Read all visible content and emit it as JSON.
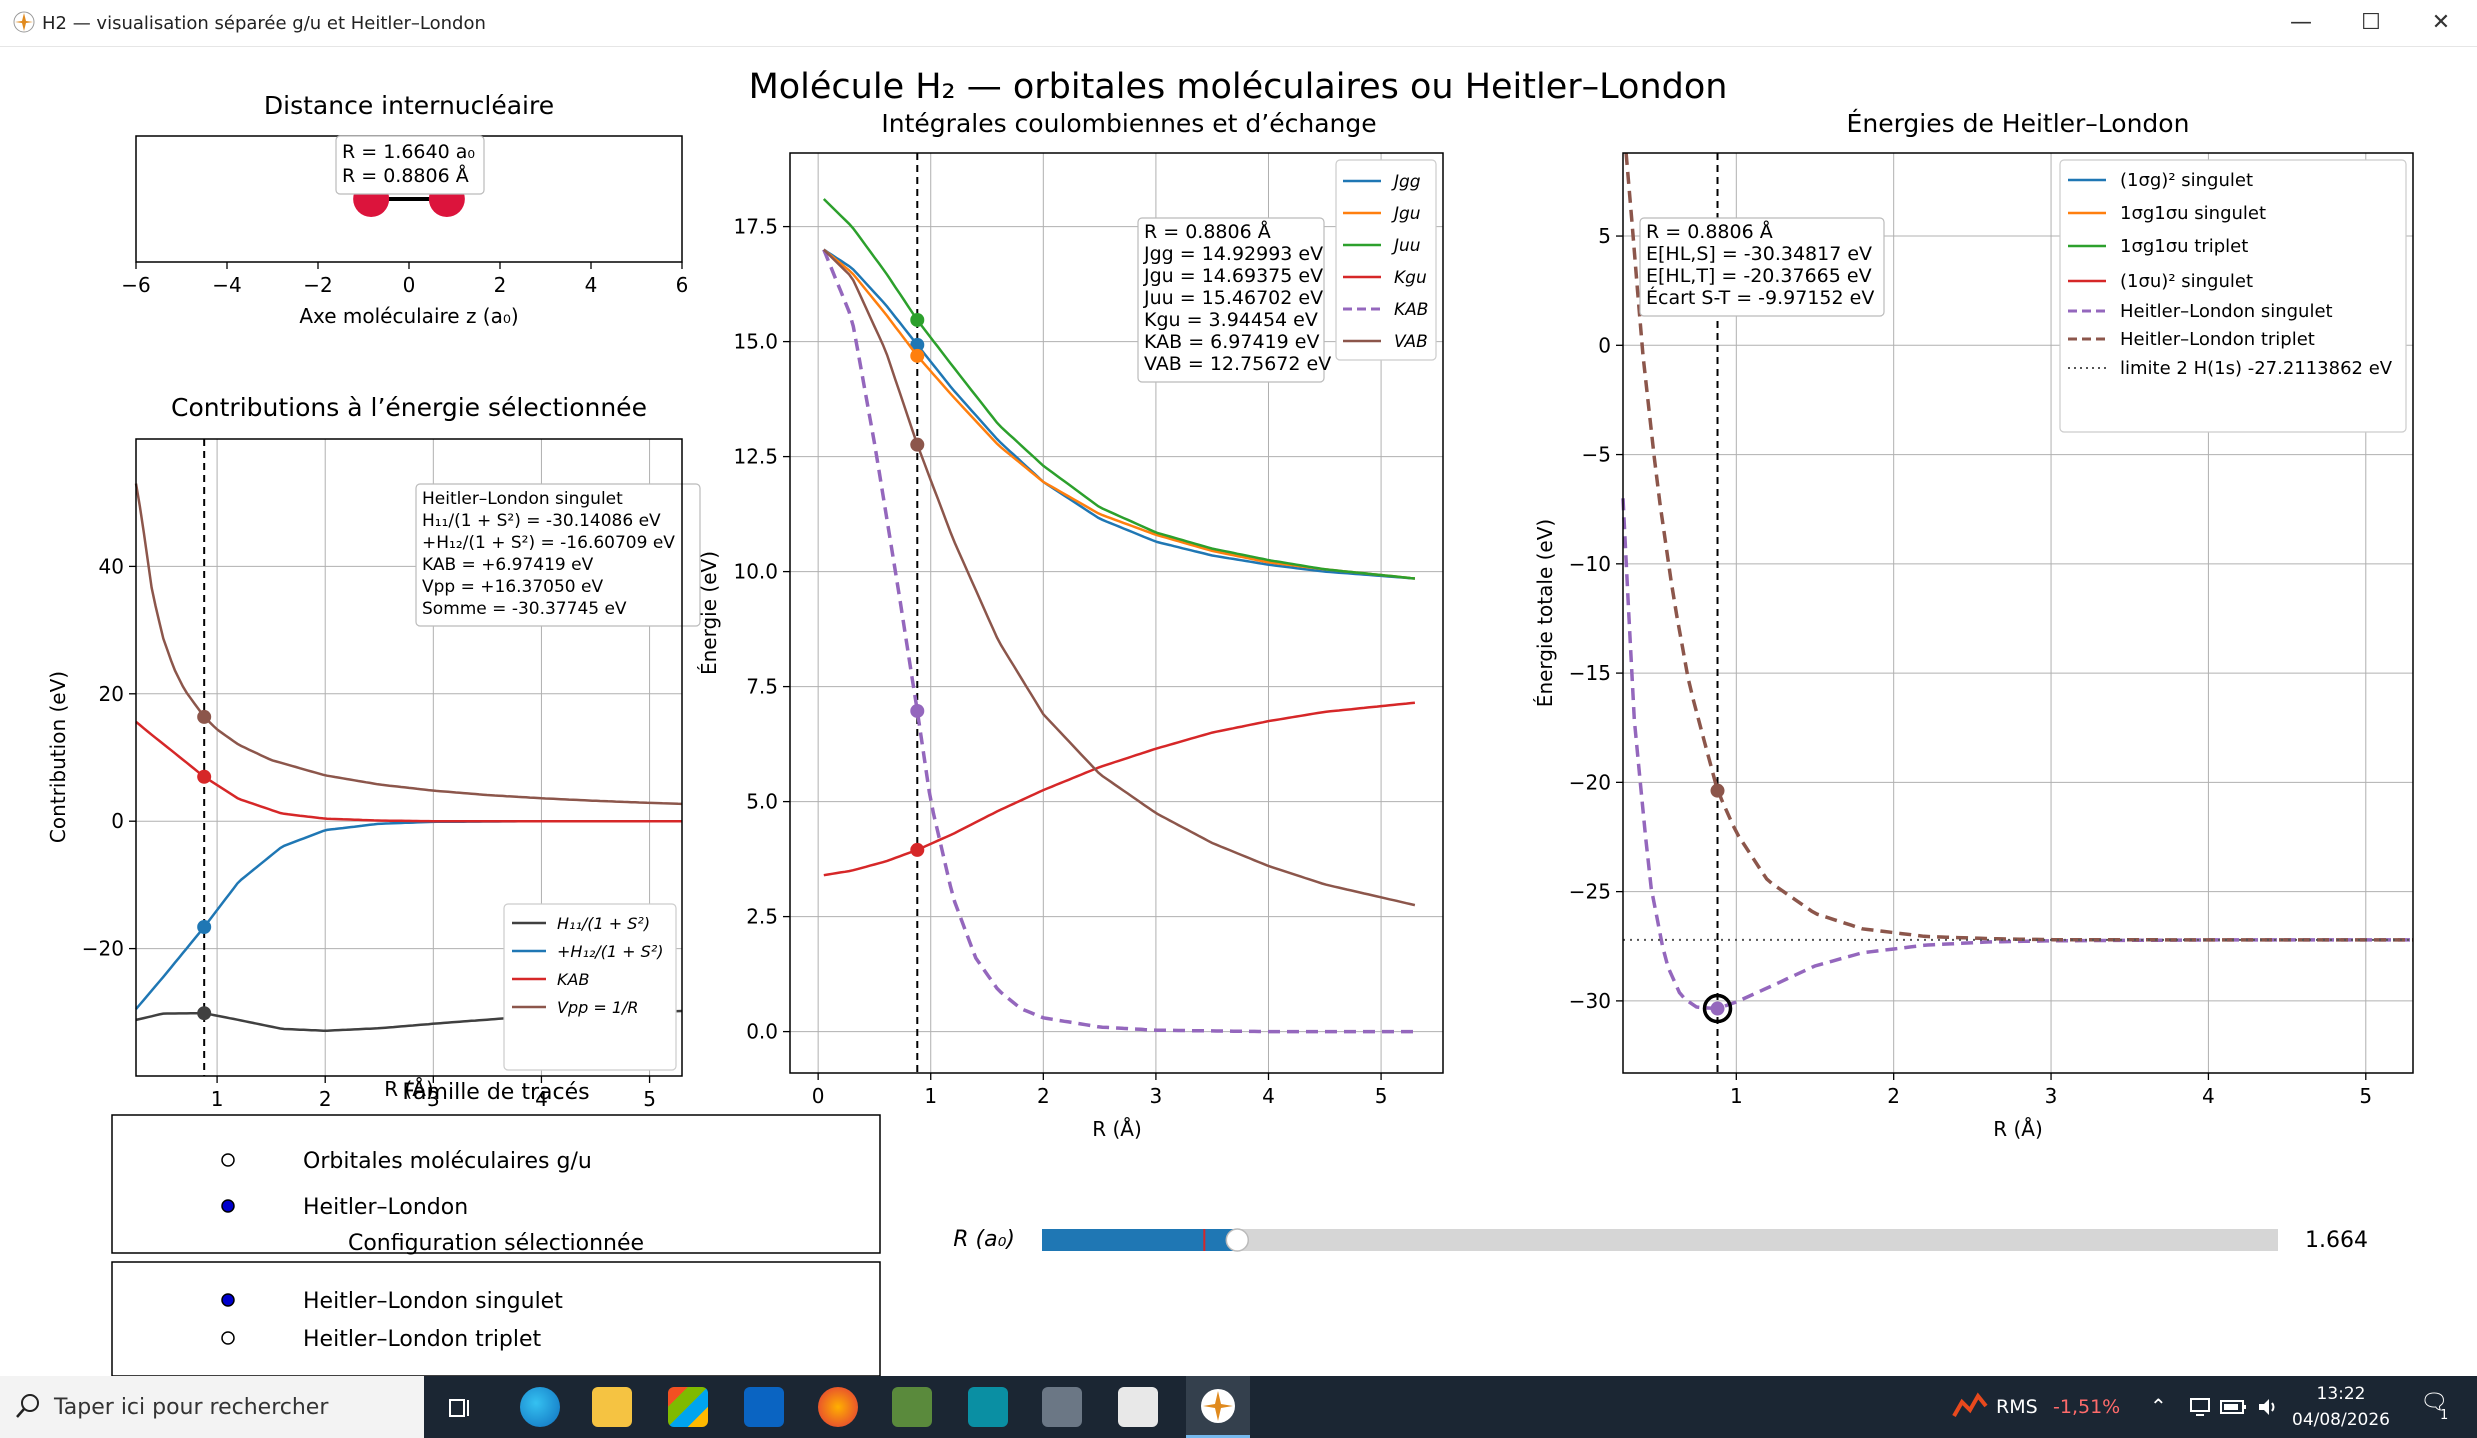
{
  "window": {
    "title": "H2 — visualisation séparée g/u et Heitler–London",
    "minimize_glyph": "—",
    "maximize_glyph": "☐",
    "close_glyph": "✕"
  },
  "suptitle": "Molécule H₂ — orbitales moléculaires ou Heitler–London",
  "chart_data": [
    {
      "id": "distance",
      "type": "scatter",
      "title": "Distance internucléaire",
      "xlabel": "Axe moléculaire z (a₀)",
      "ylabel": "",
      "xlim": [
        -6,
        6
      ],
      "xticks": [
        -6,
        -4,
        -2,
        0,
        2,
        4,
        6
      ],
      "xtick_labels": [
        "−6",
        "−4",
        "−2",
        "0",
        "2",
        "4",
        "6"
      ],
      "atoms_z": [
        -0.832,
        0.832
      ],
      "atom_color": "#dc143c",
      "annotation": [
        "R = 1.6640 a₀",
        "R = 0.8806 Å"
      ]
    },
    {
      "id": "contributions",
      "type": "line",
      "title": "Contributions à l’énergie sélectionnée",
      "xlabel": "R (Å)",
      "ylabel": "Contribution (eV)",
      "xlim": [
        0.25,
        5.3
      ],
      "ylim": [
        -40,
        60
      ],
      "xticks": [
        1,
        2,
        3,
        4,
        5
      ],
      "yticks": [
        -20,
        0,
        20,
        40
      ],
      "ytick_labels": [
        "−20",
        "0",
        "20",
        "40"
      ],
      "grid": true,
      "marker_x": 0.8806,
      "legend_position": "lower-right",
      "series": [
        {
          "name": "H₁₁/(1 + S²)",
          "color": "#404040",
          "x": [
            0.25,
            0.5,
            0.8806,
            1.2,
            1.6,
            2.0,
            2.5,
            3.0,
            4.0,
            5.3
          ],
          "y": [
            -31.2,
            -30.2,
            -30.14,
            -31.2,
            -32.6,
            -32.9,
            -32.5,
            -31.8,
            -30.5,
            -29.8
          ],
          "marker": -30.14
        },
        {
          "name": "+H₁₂/(1 + S²)",
          "color": "#1f77b4",
          "x": [
            0.25,
            0.5,
            0.8806,
            1.2,
            1.6,
            2.0,
            2.5,
            3.0,
            4.0,
            5.3
          ],
          "y": [
            -29.5,
            -24.5,
            -16.61,
            -9.5,
            -4.0,
            -1.4,
            -0.4,
            -0.1,
            0,
            0
          ],
          "marker": -16.61
        },
        {
          "name": "KAB",
          "color": "#d62728",
          "x": [
            0.25,
            0.4,
            0.6,
            0.8806,
            1.2,
            1.6,
            2.0,
            2.5,
            3.0,
            4.0,
            5.3
          ],
          "y": [
            15.6,
            13.5,
            10.8,
            6.97,
            3.5,
            1.2,
            0.4,
            0.1,
            0,
            0,
            0
          ],
          "marker": 6.97
        },
        {
          "name": "Vpp = 1/R",
          "color": "#8c564b",
          "x": [
            0.25,
            0.3,
            0.4,
            0.5,
            0.6,
            0.7,
            0.8806,
            1.0,
            1.2,
            1.5,
            2.0,
            2.5,
            3.0,
            3.5,
            4.0,
            4.5,
            5.0,
            5.3
          ],
          "y": [
            53,
            48.0,
            36.0,
            28.8,
            24.0,
            20.6,
            16.37,
            14.4,
            12.0,
            9.6,
            7.2,
            5.76,
            4.8,
            4.11,
            3.6,
            3.2,
            2.88,
            2.72
          ],
          "marker": 16.37
        }
      ],
      "annotation": [
        "Heitler–London singulet",
        "H₁₁/(1 + S²) = -30.14086 eV",
        "+H₁₂/(1 + S²) = -16.60709 eV",
        "KAB = +6.97419 eV",
        "Vpp = +16.37050 eV",
        "Somme = -30.37745 eV"
      ]
    },
    {
      "id": "integrales",
      "type": "line",
      "title": "Intégrales coulombiennes et d’échange",
      "xlabel": "R (Å)",
      "ylabel": "Énergie (eV)",
      "xlim": [
        -0.25,
        5.55
      ],
      "ylim": [
        -0.9,
        19.1
      ],
      "xticks": [
        0,
        1,
        2,
        3,
        4,
        5
      ],
      "yticks": [
        0,
        2.5,
        5,
        7.5,
        10,
        12.5,
        15,
        17.5
      ],
      "ytick_labels": [
        "0.0",
        "2.5",
        "5.0",
        "7.5",
        "10.0",
        "12.5",
        "15.0",
        "17.5"
      ],
      "grid": true,
      "marker_x": 0.8806,
      "legend_position": "upper-right",
      "series": [
        {
          "name": "Jgg",
          "color": "#1f77b4",
          "dash": false,
          "x": [
            0.05,
            0.3,
            0.6,
            0.8806,
            1.2,
            1.6,
            2.0,
            2.5,
            3.0,
            3.5,
            4.0,
            4.5,
            5.3
          ],
          "y": [
            17.0,
            16.6,
            15.8,
            14.93,
            13.95,
            12.85,
            11.95,
            11.15,
            10.65,
            10.35,
            10.15,
            10.0,
            9.85
          ],
          "marker": 14.93
        },
        {
          "name": "Jgu",
          "color": "#ff7f0e",
          "dash": false,
          "x": [
            0.05,
            0.3,
            0.6,
            0.8806,
            1.2,
            1.6,
            2.0,
            2.5,
            3.0,
            3.5,
            4.0,
            4.5,
            5.3
          ],
          "y": [
            17.0,
            16.5,
            15.6,
            14.69,
            13.8,
            12.75,
            11.95,
            11.25,
            10.8,
            10.45,
            10.2,
            10.05,
            9.85
          ],
          "marker": 14.69
        },
        {
          "name": "Juu",
          "color": "#2ca02c",
          "dash": false,
          "x": [
            0.05,
            0.3,
            0.6,
            0.8806,
            1.2,
            1.6,
            2.0,
            2.5,
            3.0,
            3.5,
            4.0,
            4.5,
            5.3
          ],
          "y": [
            18.1,
            17.5,
            16.5,
            15.47,
            14.45,
            13.2,
            12.3,
            11.4,
            10.85,
            10.5,
            10.25,
            10.05,
            9.85
          ],
          "marker": 15.47
        },
        {
          "name": "Kgu",
          "color": "#d62728",
          "dash": false,
          "x": [
            0.05,
            0.3,
            0.6,
            0.8806,
            1.2,
            1.6,
            2.0,
            2.5,
            3.0,
            3.5,
            4.0,
            4.5,
            5.3
          ],
          "y": [
            3.4,
            3.5,
            3.7,
            3.95,
            4.3,
            4.8,
            5.25,
            5.75,
            6.15,
            6.5,
            6.75,
            6.95,
            7.15
          ],
          "marker": 3.95
        },
        {
          "name": "KAB",
          "color": "#9467bd",
          "dash": true,
          "x": [
            0.05,
            0.3,
            0.5,
            0.7,
            0.8806,
            1.0,
            1.2,
            1.4,
            1.6,
            1.8,
            2.0,
            2.5,
            3.0,
            4.0,
            5.3
          ],
          "y": [
            17.0,
            15.5,
            12.8,
            9.8,
            6.97,
            5.0,
            2.9,
            1.6,
            0.9,
            0.5,
            0.3,
            0.1,
            0.03,
            0.0,
            0.0
          ],
          "marker": 6.97
        },
        {
          "name": "VAB",
          "color": "#8c564b",
          "dash": false,
          "x": [
            0.05,
            0.3,
            0.6,
            0.8806,
            1.2,
            1.6,
            2.0,
            2.5,
            3.0,
            3.5,
            4.0,
            4.5,
            5.3
          ],
          "y": [
            17.0,
            16.4,
            14.8,
            12.76,
            10.7,
            8.5,
            6.9,
            5.6,
            4.75,
            4.1,
            3.6,
            3.2,
            2.75
          ],
          "marker": 12.76
        }
      ],
      "annotation": [
        "R = 0.8806 Å",
        "Jgg = 14.92993 eV",
        "Jgu = 14.69375 eV",
        "Juu = 15.46702 eV",
        "Kgu = 3.94454 eV",
        "KAB = 6.97419 eV",
        "VAB = 12.75672 eV"
      ]
    },
    {
      "id": "energies",
      "type": "line",
      "title": "Énergies de Heitler–London",
      "xlabel": "R (Å)",
      "ylabel": "Énergie totale (eV)",
      "xlim": [
        0.28,
        5.3
      ],
      "ylim": [
        -33.3,
        8.8
      ],
      "xticks": [
        1,
        2,
        3,
        4,
        5
      ],
      "yticks": [
        -30,
        -25,
        -20,
        -15,
        -10,
        -5,
        0,
        5
      ],
      "ytick_labels": [
        "−30",
        "−25",
        "−20",
        "−15",
        "−10",
        "−5",
        "0",
        "5"
      ],
      "grid": true,
      "marker_x": 0.8806,
      "legend_position": "upper-right",
      "series": [
        {
          "name": "(1σg)² singulet",
          "color": "#1f77b4",
          "dash": "solid",
          "x": [],
          "y": []
        },
        {
          "name": "1σg1σu singulet",
          "color": "#ff7f0e",
          "dash": "solid",
          "x": [],
          "y": []
        },
        {
          "name": "1σg1σu triplet",
          "color": "#2ca02c",
          "dash": "solid",
          "x": [],
          "y": []
        },
        {
          "name": "(1σu)² singulet",
          "color": "#d62728",
          "dash": "solid",
          "x": [],
          "y": []
        },
        {
          "name": "Heitler–London singulet",
          "color": "#9467bd",
          "dash": "dashed",
          "x": [
            0.28,
            0.35,
            0.45,
            0.55,
            0.65,
            0.75,
            0.8806,
            1.0,
            1.2,
            1.5,
            1.8,
            2.2,
            2.6,
            3.0,
            4.0,
            5.3
          ],
          "y": [
            -7.0,
            -17.0,
            -24.5,
            -28.2,
            -29.8,
            -30.3,
            -30.35,
            -30.05,
            -29.4,
            -28.4,
            -27.8,
            -27.45,
            -27.3,
            -27.25,
            -27.21,
            -27.21
          ],
          "marker": -30.35,
          "highlight": true
        },
        {
          "name": "Heitler–London triplet",
          "color": "#8c564b",
          "dash": "dashed",
          "x": [
            0.3,
            0.35,
            0.4,
            0.5,
            0.6,
            0.7,
            0.8806,
            1.0,
            1.2,
            1.5,
            1.8,
            2.2,
            2.6,
            3.0,
            4.0,
            5.3
          ],
          "y": [
            8.8,
            4.5,
            0.0,
            -6.5,
            -11.5,
            -15.5,
            -20.38,
            -22.3,
            -24.5,
            -26.0,
            -26.7,
            -27.05,
            -27.15,
            -27.2,
            -27.21,
            -27.21
          ],
          "marker": -20.38
        },
        {
          "name": "limite 2 H(1s)  -27.2113862 eV",
          "color": "#555555",
          "dash": "dotted",
          "x": [
            0.28,
            5.3
          ],
          "y": [
            -27.2113862,
            -27.2113862
          ]
        }
      ],
      "annotation": [
        "R = 0.8806 Å",
        "E[HL,S] = -30.34817 eV",
        "E[HL,T] = -20.37665 eV",
        "Écart S-T = -9.97152 eV"
      ]
    }
  ],
  "radio_family": {
    "title": "Famille de tracés",
    "options": [
      "Orbitales moléculaires g/u",
      "Heitler–London"
    ],
    "selected": 1
  },
  "radio_config": {
    "title": "Configuration sélectionnée",
    "options": [
      "Heitler–London singulet",
      "Heitler–London triplet"
    ],
    "selected": 0
  },
  "slider": {
    "label": "R (a₀)",
    "value_text": "1.664",
    "min": 0.1,
    "max": 10.0,
    "value": 1.664,
    "initial_marker": 1.4
  },
  "taskbar": {
    "search_placeholder": "Taper ici pour rechercher",
    "rms_label": "RMS",
    "rms_value": "-1,51%",
    "time": "13:22",
    "date": "04/08/2026",
    "notifications": "1",
    "apps": [
      "task-view",
      "edge",
      "file-explorer",
      "store",
      "outlook",
      "firefox",
      "image-editor",
      "app-terminal",
      "app-camera",
      "app-python-doc",
      "app-active"
    ]
  }
}
